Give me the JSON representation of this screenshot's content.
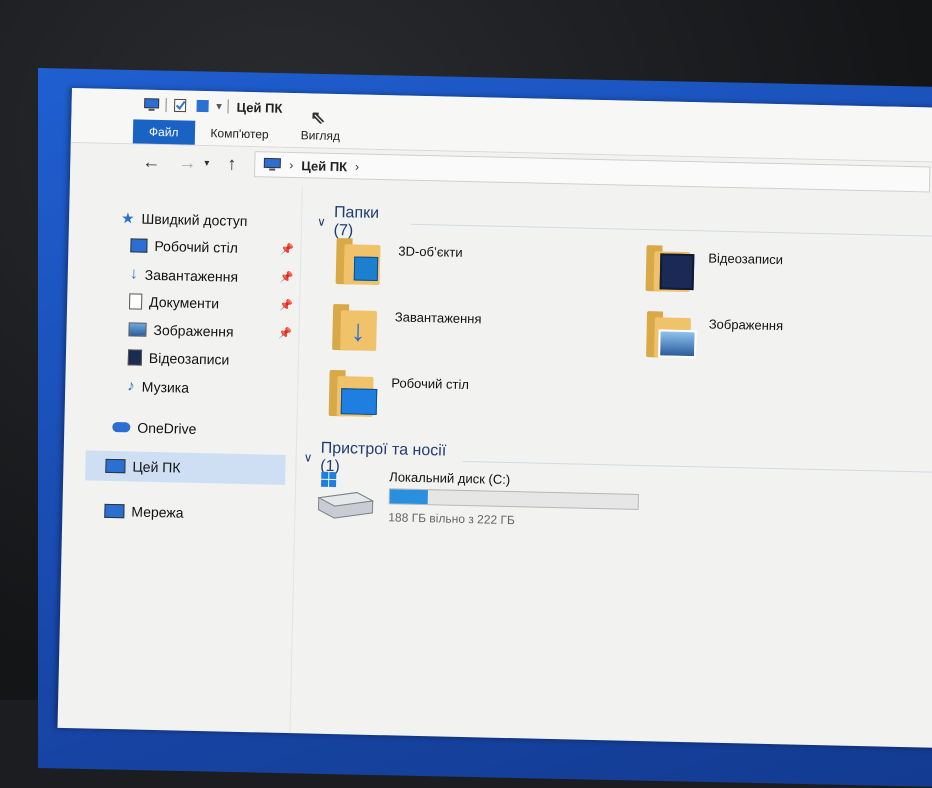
{
  "title": {
    "window_title": "Цей ПК"
  },
  "ribbon": {
    "tabs": [
      {
        "label": "Файл",
        "active": true
      },
      {
        "label": "Комп'ютер",
        "active": false
      },
      {
        "label": "Вигляд",
        "active": false
      }
    ]
  },
  "address": {
    "crumb": "Цей ПК"
  },
  "nav": {
    "items": [
      {
        "label": "Швидкий доступ",
        "icon": "star-icon"
      },
      {
        "label": "Робочий стіл",
        "icon": "desktop-folder-icon",
        "pinned": true
      },
      {
        "label": "Завантаження",
        "icon": "download-icon",
        "pinned": true
      },
      {
        "label": "Документи",
        "icon": "documents-icon",
        "pinned": true
      },
      {
        "label": "Зображення",
        "icon": "pictures-icon",
        "pinned": true
      },
      {
        "label": "Відеозаписи",
        "icon": "videos-icon"
      },
      {
        "label": "Музика",
        "icon": "music-icon"
      },
      {
        "label": "OneDrive",
        "icon": "cloud-icon"
      },
      {
        "label": "Цей ПК",
        "icon": "computer-icon",
        "selected": true
      },
      {
        "label": "Мережа",
        "icon": "network-icon"
      }
    ]
  },
  "content": {
    "folders_header": "Папки (7)",
    "folders": [
      {
        "label": "3D-об’єкти",
        "icon": "3d-objects-icon"
      },
      {
        "label": "Відеозаписи",
        "icon": "videos-icon"
      },
      {
        "label": "Завантаження",
        "icon": "download-icon"
      },
      {
        "label": "Зображення",
        "icon": "pictures-icon"
      },
      {
        "label": "Робочий стіл",
        "icon": "desktop-folder-icon"
      }
    ],
    "devices_header": "Пристрої та носії (1)",
    "drive": {
      "label": "Локальний диск (C:)",
      "free_text": "188 ГБ вільно з 222 ГБ",
      "used_fraction": 0.153
    }
  },
  "colors": {
    "accent": "#1a62c4",
    "folder": "#f0c36a",
    "drive_fill": "#2b8fe0",
    "nav_selected": "#cfdff3"
  }
}
